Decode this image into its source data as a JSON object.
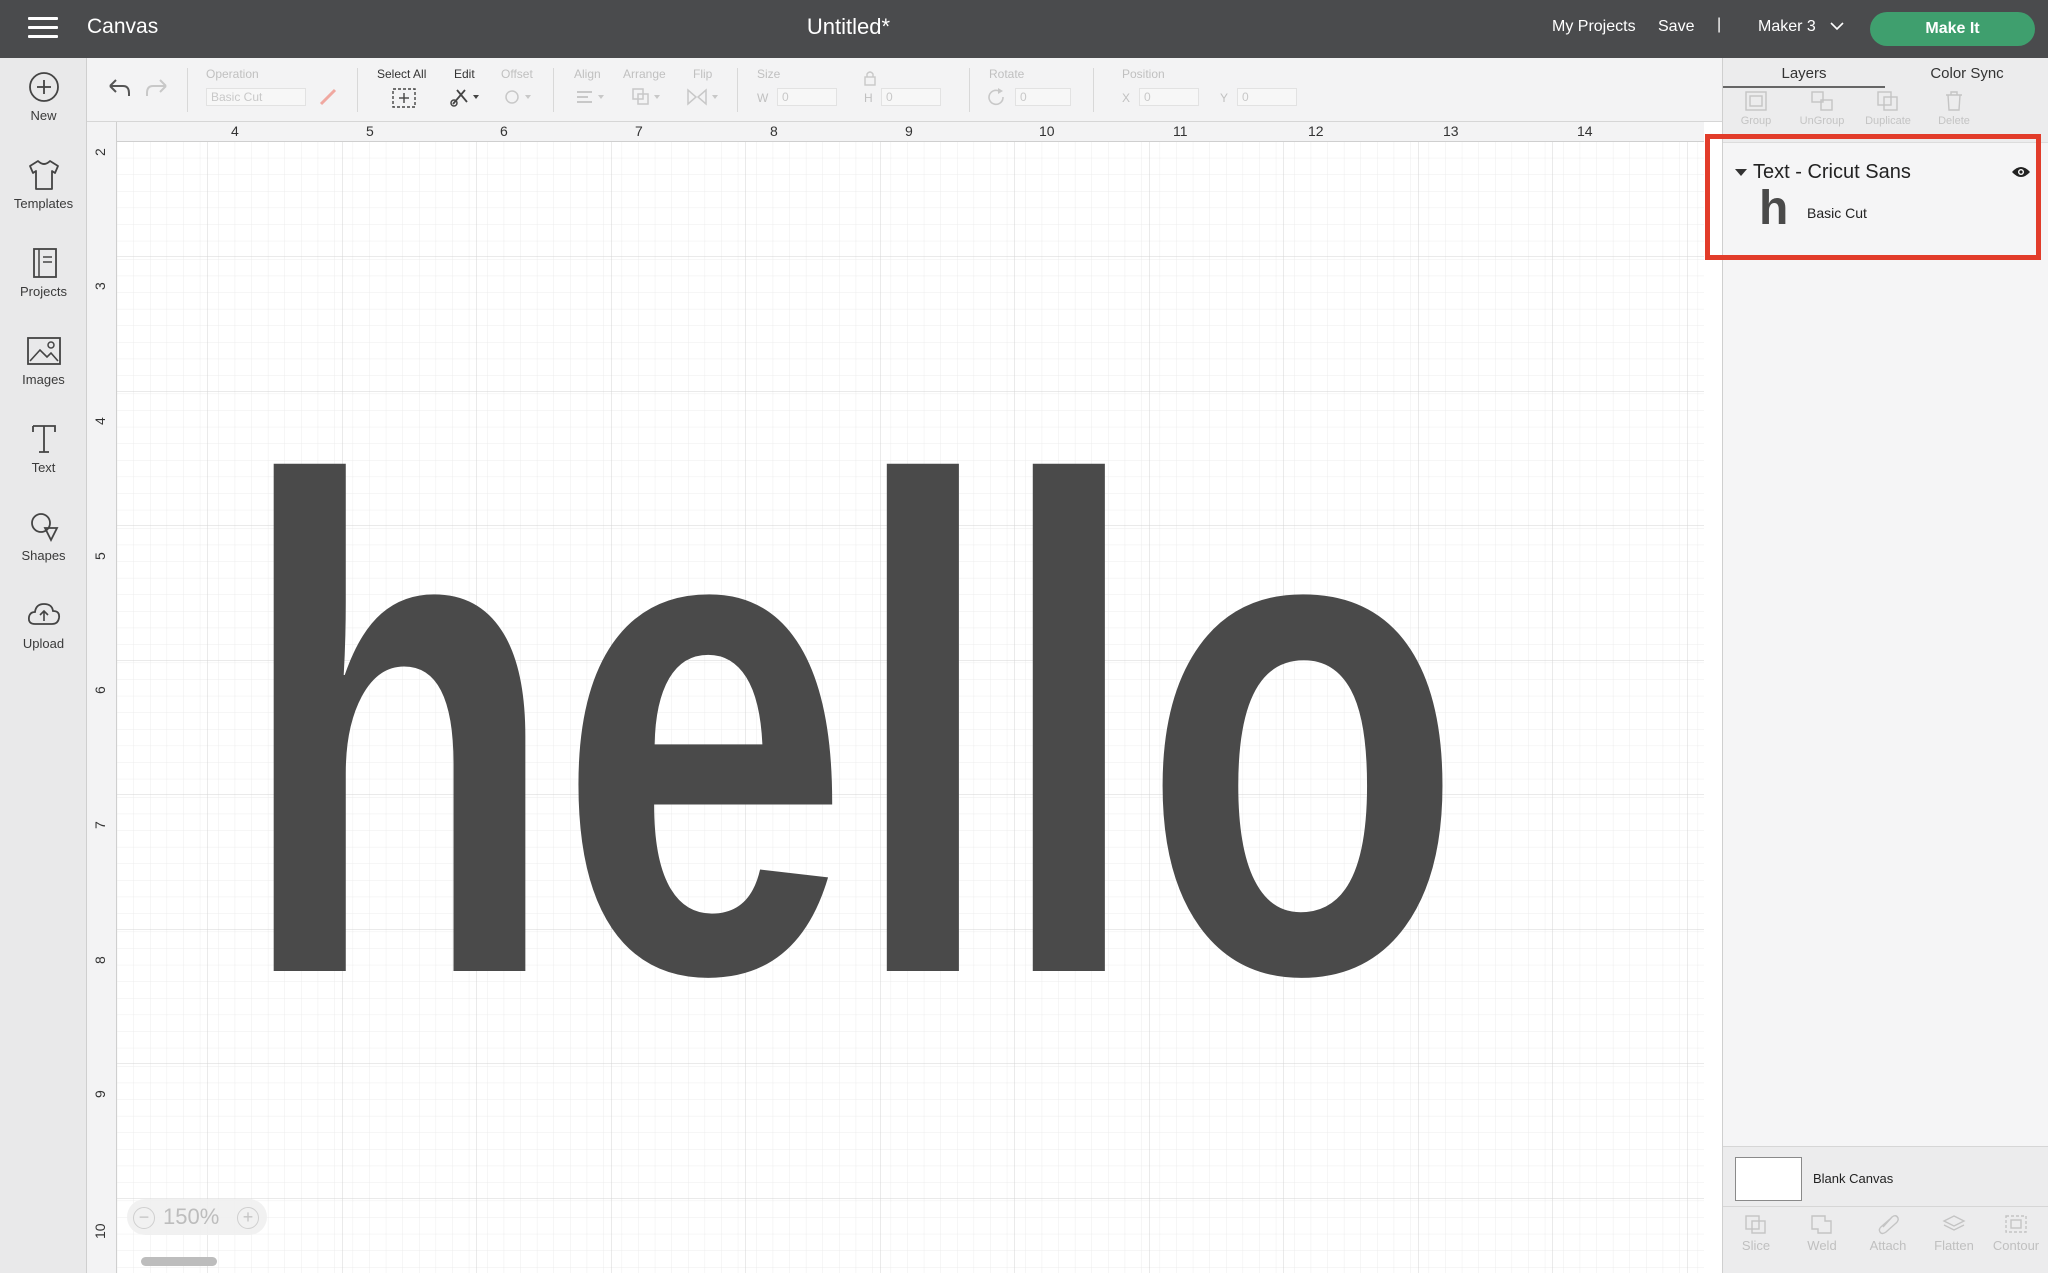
{
  "topbar": {
    "app_title": "Canvas",
    "document_title": "Untitled*",
    "my_projects": "My Projects",
    "save": "Save",
    "separator": "|",
    "machine": "Maker 3",
    "make_it": "Make It",
    "make_it_color": "#3f9f6e"
  },
  "leftrail": {
    "tools": [
      {
        "label": "New",
        "icon": "plus-circle-icon"
      },
      {
        "label": "Templates",
        "icon": "tshirt-icon"
      },
      {
        "label": "Projects",
        "icon": "notebook-icon"
      },
      {
        "label": "Images",
        "icon": "image-icon"
      },
      {
        "label": "Text",
        "icon": "text-t-icon"
      },
      {
        "label": "Shapes",
        "icon": "shapes-icon"
      },
      {
        "label": "Upload",
        "icon": "cloud-upload-icon"
      }
    ]
  },
  "toolbar": {
    "operation_label": "Operation",
    "operation_value": "Basic Cut",
    "select_all": "Select All",
    "edit": "Edit",
    "offset": "Offset",
    "align": "Align",
    "arrange": "Arrange",
    "flip": "Flip",
    "size": "Size",
    "w_label": "W",
    "w_value": "0",
    "h_label": "H",
    "h_value": "0",
    "rotate": "Rotate",
    "rotate_value": "0",
    "position": "Position",
    "x_label": "X",
    "x_value": "0",
    "y_label": "Y",
    "y_value": "0"
  },
  "canvas": {
    "text": "hello",
    "text_color": "#4a4a4a",
    "ruler_top": [
      "4",
      "5",
      "6",
      "7",
      "8",
      "9",
      "10",
      "11",
      "12",
      "13",
      "14"
    ],
    "ruler_left": [
      "2",
      "3",
      "4",
      "5",
      "6",
      "7",
      "8",
      "9",
      "10"
    ],
    "zoom": "150%",
    "zoom_out": "−",
    "zoom_in": "+"
  },
  "rightpanel": {
    "tabs": [
      "Layers",
      "Color Sync"
    ],
    "actions": [
      "Group",
      "UnGroup",
      "Duplicate",
      "Delete"
    ],
    "layer_group": "Text - Cricut Sans",
    "layer_thumb": "h",
    "layer_item": "Basic Cut",
    "blank_canvas": "Blank Canvas",
    "bottom_actions": [
      "Slice",
      "Weld",
      "Attach",
      "Flatten",
      "Contour"
    ],
    "highlight_color": "#e23c2a"
  }
}
